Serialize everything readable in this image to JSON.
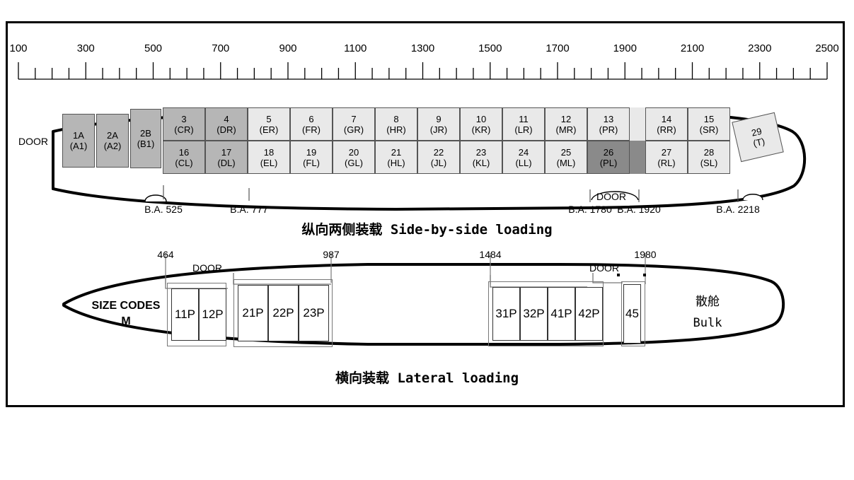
{
  "ruler": {
    "min": 100,
    "max": 2500,
    "major_step": 200,
    "minor_step": 50,
    "labels": [
      "100",
      "300",
      "500",
      "700",
      "900",
      "1100",
      "1300",
      "1500",
      "1700",
      "1900",
      "2100",
      "2300",
      "2500"
    ]
  },
  "upper": {
    "title_cn": "纵向两侧装载",
    "title_en": "Side-by-side loading",
    "door_front": "DOOR",
    "door_rear": "DOOR",
    "cells_top": [
      {
        "num": "1A",
        "code": "(A1)",
        "shade": "mid"
      },
      {
        "num": "2A",
        "code": "(A2)",
        "shade": "mid"
      },
      {
        "num": "2B",
        "code": "(B1)",
        "shade": "mid"
      },
      {
        "num": "3",
        "code": "(CR)",
        "shade": "mid"
      },
      {
        "num": "4",
        "code": "(DR)",
        "shade": "mid"
      },
      {
        "num": "5",
        "code": "(ER)",
        "shade": "light"
      },
      {
        "num": "6",
        "code": "(FR)",
        "shade": "light"
      },
      {
        "num": "7",
        "code": "(GR)",
        "shade": "light"
      },
      {
        "num": "8",
        "code": "(HR)",
        "shade": "light"
      },
      {
        "num": "9",
        "code": "(JR)",
        "shade": "light"
      },
      {
        "num": "10",
        "code": "(KR)",
        "shade": "light"
      },
      {
        "num": "11",
        "code": "(LR)",
        "shade": "light"
      },
      {
        "num": "12",
        "code": "(MR)",
        "shade": "light"
      },
      {
        "num": "13",
        "code": "(PR)",
        "shade": "light"
      },
      {
        "num": "14",
        "code": "(RR)",
        "shade": "light"
      },
      {
        "num": "15",
        "code": "(SR)",
        "shade": "light"
      },
      {
        "num": "29",
        "code": "(T)",
        "shade": "light"
      }
    ],
    "cells_bottom": [
      {
        "num": "16",
        "code": "(CL)",
        "shade": "mid"
      },
      {
        "num": "17",
        "code": "(DL)",
        "shade": "mid"
      },
      {
        "num": "18",
        "code": "(EL)",
        "shade": "light"
      },
      {
        "num": "19",
        "code": "(FL)",
        "shade": "light"
      },
      {
        "num": "20",
        "code": "(GL)",
        "shade": "light"
      },
      {
        "num": "21",
        "code": "(HL)",
        "shade": "light"
      },
      {
        "num": "22",
        "code": "(JL)",
        "shade": "light"
      },
      {
        "num": "23",
        "code": "(KL)",
        "shade": "light"
      },
      {
        "num": "24",
        "code": "(LL)",
        "shade": "light"
      },
      {
        "num": "25",
        "code": "(ML)",
        "shade": "light"
      },
      {
        "num": "26",
        "code": "(PL)",
        "shade": "dark"
      },
      {
        "num": "27",
        "code": "(RL)",
        "shade": "light"
      },
      {
        "num": "28",
        "code": "(SL)",
        "shade": "light"
      }
    ],
    "ba_labels": [
      "B.A. 525",
      "B.A. 777",
      "B.A. 1780",
      "B.A. 1920",
      "B.A. 2218"
    ]
  },
  "lower": {
    "title_cn": "横向装载",
    "title_en": "Lateral loading",
    "size_codes_label": "SIZE CODES",
    "size_codes_value": "M",
    "door_front": "DOOR",
    "door_rear": "DOOR",
    "dims": [
      "464",
      "987",
      "1484",
      "1980"
    ],
    "cells_group1": [
      "11P",
      "12P"
    ],
    "cells_group2": [
      "21P",
      "22P",
      "23P"
    ],
    "cells_group3": [
      "31P",
      "32P",
      "41P",
      "42P"
    ],
    "cells_group4": [
      "45"
    ],
    "bulk_cn": "散舱",
    "bulk_en": "Bulk"
  },
  "colors": {
    "outline": "#000000",
    "cell_light": "#e9e9e9",
    "cell_mid": "#b6b6b6",
    "cell_dark": "#8a8a8a"
  }
}
